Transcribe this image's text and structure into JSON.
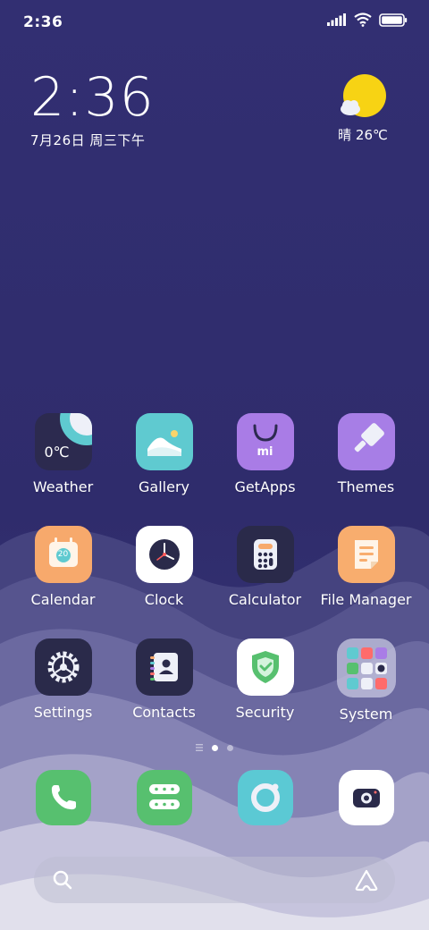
{
  "status_bar": {
    "time": "2:36"
  },
  "clock_widget": {
    "time": "2:36",
    "date": "7月26日 周三下午"
  },
  "weather_widget": {
    "condition_temp": "晴 26℃",
    "icon": "sunny-cloud-icon"
  },
  "weather_app_temp": "0℃",
  "apps": [
    {
      "label": "Weather",
      "icon": "weather-icon"
    },
    {
      "label": "Gallery",
      "icon": "gallery-icon"
    },
    {
      "label": "GetApps",
      "icon": "getapps-icon",
      "badge_text": "mi"
    },
    {
      "label": "Themes",
      "icon": "themes-icon"
    },
    {
      "label": "Calendar",
      "icon": "calendar-icon",
      "day": "20"
    },
    {
      "label": "Clock",
      "icon": "clock-icon"
    },
    {
      "label": "Calculator",
      "icon": "calculator-icon"
    },
    {
      "label": "File Manager",
      "icon": "file-manager-icon"
    },
    {
      "label": "Settings",
      "icon": "settings-icon"
    },
    {
      "label": "Contacts",
      "icon": "contacts-icon"
    },
    {
      "label": "Security",
      "icon": "security-icon"
    },
    {
      "label": "System",
      "icon": "system-folder-icon"
    }
  ],
  "page_indicator": {
    "pages": 2,
    "current": 1
  },
  "dock": [
    {
      "icon": "phone-icon"
    },
    {
      "icon": "messages-icon"
    },
    {
      "icon": "browser-icon"
    },
    {
      "icon": "camera-icon"
    }
  ],
  "search": {
    "icon": "search-icon",
    "assistant_icon": "assistant-icon"
  },
  "colors": {
    "wallpaper": "#2e2b6b",
    "wave_light": "#e6e4f0",
    "weather_bg": "#2c2a4f",
    "gallery_bg": "#5fcad0",
    "getapps_bg": "#a97ce6",
    "themes_bg": "#a77ee6",
    "calendar_bg": "#f7a96c",
    "calculator_bg": "#2a2a4a",
    "file_manager_bg": "#f8ad6e",
    "phone_bg": "#57c06f",
    "messages_bg": "#57c06f",
    "browser_bg": "#5bc9d4"
  }
}
